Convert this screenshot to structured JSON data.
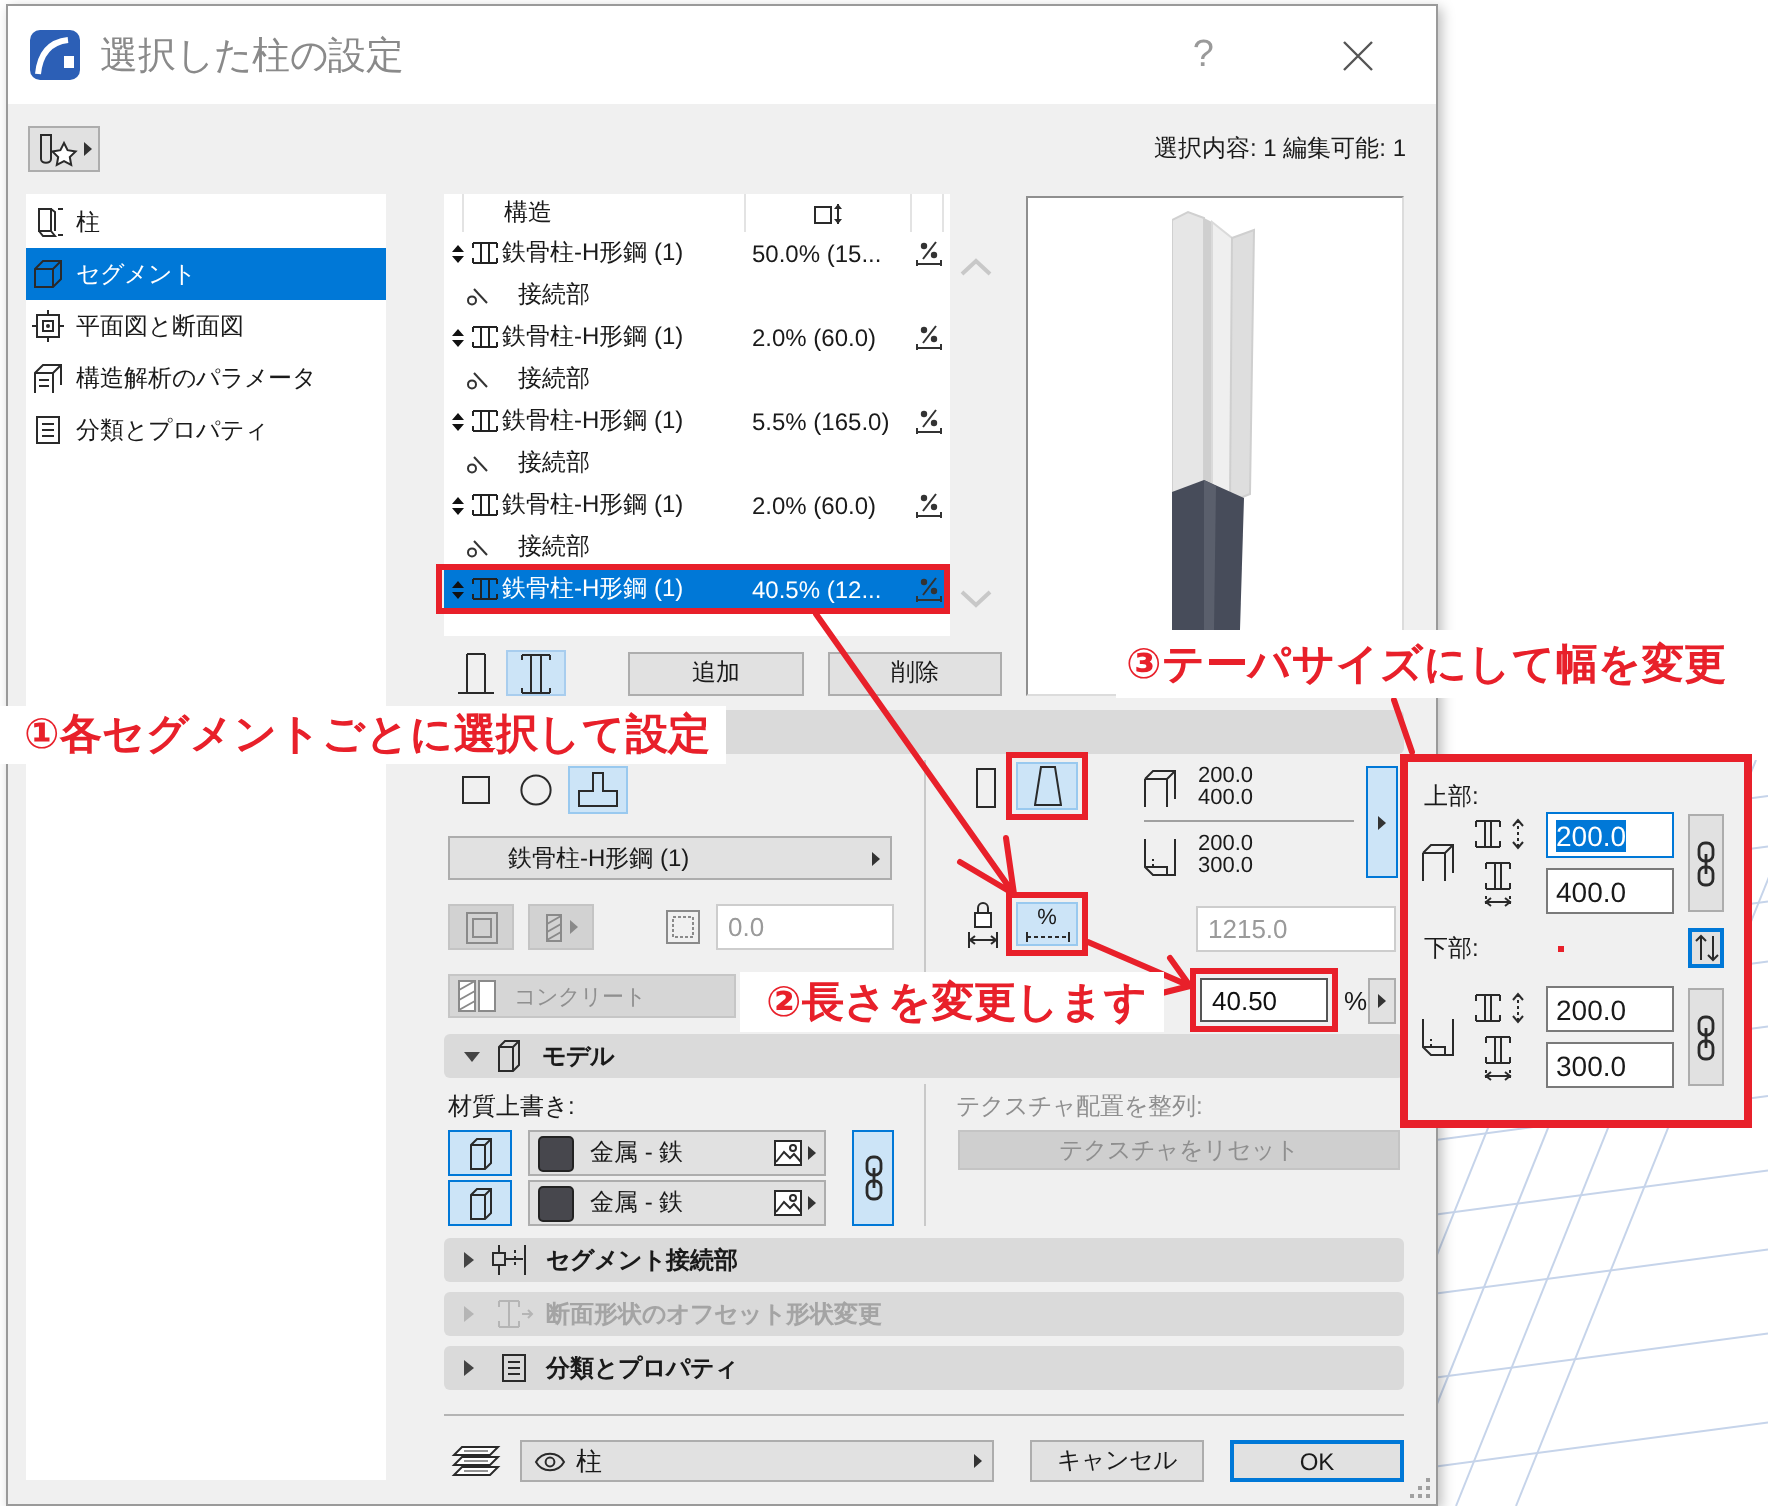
{
  "window": {
    "title": "選択した柱の設定",
    "help": "?"
  },
  "toolbar": {
    "selection_info": "選択内容: 1 編集可能: 1"
  },
  "sidebar": {
    "items": [
      {
        "label": "柱",
        "selected": false
      },
      {
        "label": "セグメント",
        "selected": true
      },
      {
        "label": "平面図と断面図",
        "selected": false
      },
      {
        "label": "構造解析のパラメータ",
        "selected": false
      },
      {
        "label": "分類とプロパティ",
        "selected": false
      }
    ]
  },
  "segment_list": {
    "columns": [
      {
        "label": "構造"
      }
    ],
    "rows": [
      {
        "kind": "segment",
        "name": "鉄骨柱-H形鋼 (1)",
        "length": "50.0% (15...",
        "selected": false
      },
      {
        "kind": "connector",
        "name": "接続部",
        "selected": false
      },
      {
        "kind": "segment",
        "name": "鉄骨柱-H形鋼 (1)",
        "length": "2.0% (60.0)",
        "selected": false
      },
      {
        "kind": "connector",
        "name": "接続部",
        "selected": false
      },
      {
        "kind": "segment",
        "name": "鉄骨柱-H形鋼 (1)",
        "length": "5.5% (165.0)",
        "selected": false
      },
      {
        "kind": "connector",
        "name": "接続部",
        "selected": false
      },
      {
        "kind": "segment",
        "name": "鉄骨柱-H形鋼 (1)",
        "length": "2.0% (60.0)",
        "selected": false
      },
      {
        "kind": "connector",
        "name": "接続部",
        "selected": false
      },
      {
        "kind": "segment",
        "name": "鉄骨柱-H形鋼 (1)",
        "length": "40.5% (12...",
        "selected": true
      }
    ],
    "view_modes": [
      {
        "kind": "whole",
        "selected": false
      },
      {
        "kind": "segmented",
        "selected": true
      }
    ],
    "add_button": "追加",
    "delete_button": "削除"
  },
  "segment": {
    "shapes": [
      {
        "kind": "rectangle",
        "selected": false
      },
      {
        "kind": "circle",
        "selected": false
      },
      {
        "kind": "profile",
        "selected": true
      }
    ],
    "profile": "鉄骨柱-H形鋼 (1)",
    "veneer": {
      "value": "0.0",
      "disabled": true
    },
    "material": {
      "value": "コンクリート",
      "disabled": true
    },
    "taper": [
      {
        "kind": "straight",
        "selected": false
      },
      {
        "kind": "tapered",
        "selected": true
      }
    ],
    "top_size": [
      "200.0",
      "400.0"
    ],
    "bottom_size": [
      "200.0",
      "300.0"
    ],
    "length": {
      "value": "1215.0",
      "disabled": true
    },
    "percent_toggle": {
      "label": "%",
      "selected": true
    },
    "percent": {
      "value": "40.50",
      "unit": "%"
    }
  },
  "model": {
    "title": "モデル",
    "expanded": true,
    "override_label": "材質上書き:",
    "texture_label": "テクスチャ配置を整列:",
    "materials": [
      {
        "name": "金属 - 鉄",
        "color": "#47474d",
        "override": true
      },
      {
        "name": "金属 - 鉄",
        "color": "#47474d",
        "override": true
      }
    ],
    "linked": true,
    "reset_button": {
      "label": "テクスチャをリセット",
      "disabled": true
    }
  },
  "sections": [
    {
      "title": "セグメント接続部",
      "expanded": false,
      "disabled": false
    },
    {
      "title": "断面形状のオフセット形状変更",
      "expanded": false,
      "disabled": true
    },
    {
      "title": "分類とプロパティ",
      "expanded": false,
      "disabled": false
    }
  ],
  "footer": {
    "layer": "柱",
    "cancel_button": "キャンセル",
    "ok_button": "OK"
  },
  "taper_popup": {
    "open": true,
    "top_label": "上部:",
    "top": [
      {
        "value": "200.0",
        "selected": true
      },
      {
        "value": "400.0",
        "selected": false
      }
    ],
    "bottom_label": "下部:",
    "bottom": [
      {
        "value": "200.0",
        "selected": false
      },
      {
        "value": "300.0",
        "selected": false
      }
    ]
  },
  "annotations": [
    {
      "text": "①各セグメントごとに選択して設定"
    },
    {
      "text": "②長さを変更します"
    },
    {
      "text": "③テーパサイズにして幅を変更"
    }
  ]
}
